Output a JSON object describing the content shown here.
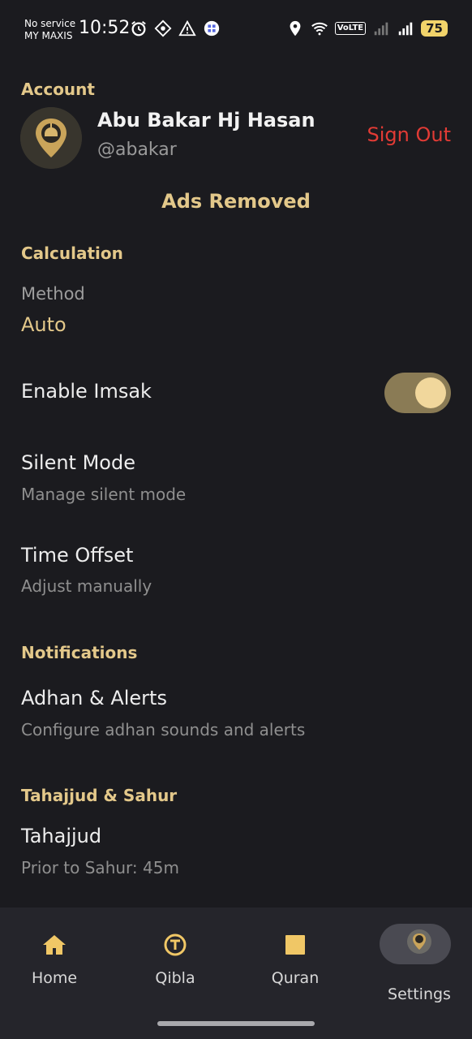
{
  "status_bar": {
    "carrier_line1": "No service",
    "carrier_line2": "MY MAXIS",
    "time": "10:52",
    "volte": "VoLTE",
    "battery": "75"
  },
  "account": {
    "section_title": "Account",
    "name": "Abu Bakar Hj Hasan",
    "handle": "@abakar",
    "sign_out_label": "Sign Out",
    "ads_status": "Ads Removed"
  },
  "calculation": {
    "section_title": "Calculation",
    "method_label": "Method",
    "method_value": "Auto",
    "enable_imsak_label": "Enable Imsak",
    "enable_imsak_on": true,
    "silent_mode_title": "Silent Mode",
    "silent_mode_sub": "Manage silent mode",
    "time_offset_title": "Time Offset",
    "time_offset_sub": "Adjust manually"
  },
  "notifications": {
    "section_title": "Notifications",
    "adhan_title": "Adhan & Alerts",
    "adhan_sub": "Configure adhan sounds and alerts"
  },
  "tahajjud": {
    "section_title": "Tahajjud & Sahur",
    "title": "Tahajjud",
    "sub": "Prior to Sahur: 45m"
  },
  "bottom_nav": {
    "items": [
      {
        "label": "Home",
        "icon": "home-icon"
      },
      {
        "label": "Qibla",
        "icon": "qibla-icon"
      },
      {
        "label": "Quran",
        "icon": "quran-icon"
      },
      {
        "label": "Settings",
        "icon": "settings-mosque-icon",
        "active": true
      }
    ]
  },
  "colors": {
    "background": "#1b1b1f",
    "accent_gold": "#e3c88a",
    "sign_out_red": "#e23b35",
    "nav_background": "#25252b"
  }
}
